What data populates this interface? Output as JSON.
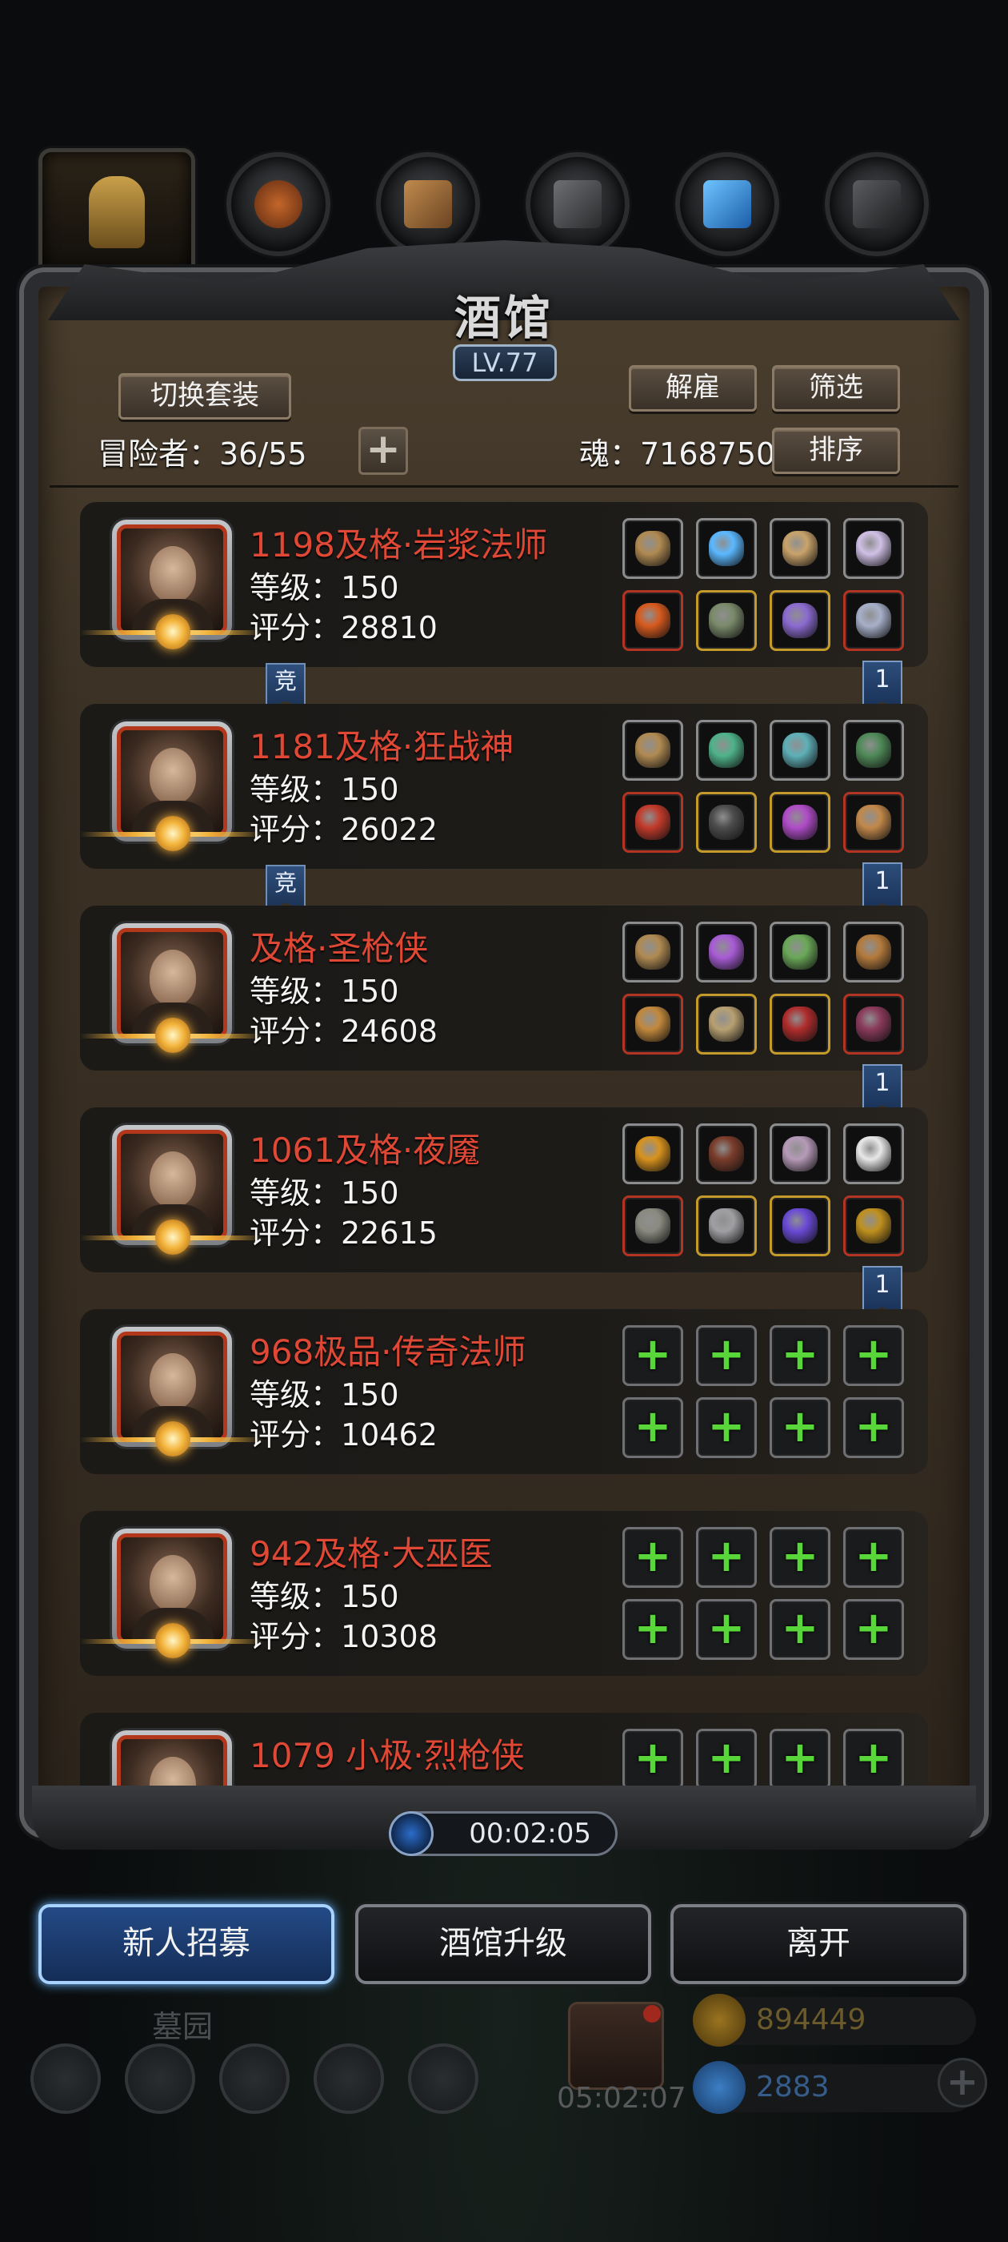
{
  "tavern": {
    "title": "酒馆",
    "level": "LV.77",
    "switch_outfit_label": "切换套装",
    "dismiss_label": "解雇",
    "filter_label": "筛选",
    "sort_label": "排序",
    "adventurers_text": "冒险者：36/55",
    "add_label": "+",
    "soul_text": "魂：7168750"
  },
  "heroes": [
    {
      "name": "1198及格·岩浆法师",
      "level_text": "等级：150",
      "score_text": "评分：28810",
      "frame_color": "#b2371b",
      "gear": "equipped",
      "tag_left": "竞",
      "tag_right": "1"
    },
    {
      "name": "1181及格·狂战神",
      "level_text": "等级：150",
      "score_text": "评分：26022",
      "frame_color": "#b2371b",
      "gear": "equipped",
      "tag_left": "竞",
      "tag_right": "1"
    },
    {
      "name": "及格·圣枪侠",
      "level_text": "等级：150",
      "score_text": "评分：24608",
      "frame_color": "#b2371b",
      "gear": "equipped",
      "tag_left": "",
      "tag_right": "1"
    },
    {
      "name": "1061及格·夜魇",
      "level_text": "等级：150",
      "score_text": "评分：22615",
      "frame_color": "#b2371b",
      "gear": "equipped",
      "tag_left": "",
      "tag_right": "1"
    },
    {
      "name": "968极品·传奇法师",
      "level_text": "等级：150",
      "score_text": "评分：10462",
      "frame_color": "#b2371b",
      "gear": "empty",
      "tag_left": "",
      "tag_right": ""
    },
    {
      "name": "942及格·大巫医",
      "level_text": "等级：150",
      "score_text": "评分：10308",
      "frame_color": "#b2371b",
      "gear": "empty",
      "tag_left": "",
      "tag_right": ""
    },
    {
      "name": "1079 小极·烈枪侠",
      "level_text": "",
      "score_text": "",
      "frame_color": "#b2371b",
      "gear": "empty",
      "tag_left": "",
      "tag_right": ""
    }
  ],
  "gear_plus": "+",
  "timer": "00:02:05",
  "actions": {
    "recruit_label": "新人招募",
    "upgrade_label": "酒馆升级",
    "leave_label": "离开"
  },
  "hud": {
    "graveyard_label": "墓园",
    "gift_timer": "05:02:07",
    "gold_value": "894449",
    "gem_value": "2883",
    "add_label": "+"
  },
  "colors": {
    "hero_name": "#e04836",
    "empty_slot_plus": "#58d63a",
    "primary_button_glow": "#5eb1ff"
  },
  "icons": {
    "top_tabs": [
      "hero-tab-icon",
      "food-tab-icon",
      "wood-tab-icon",
      "stone-tab-icon",
      "crystal-tab-icon",
      "iron-tab-icon"
    ]
  }
}
